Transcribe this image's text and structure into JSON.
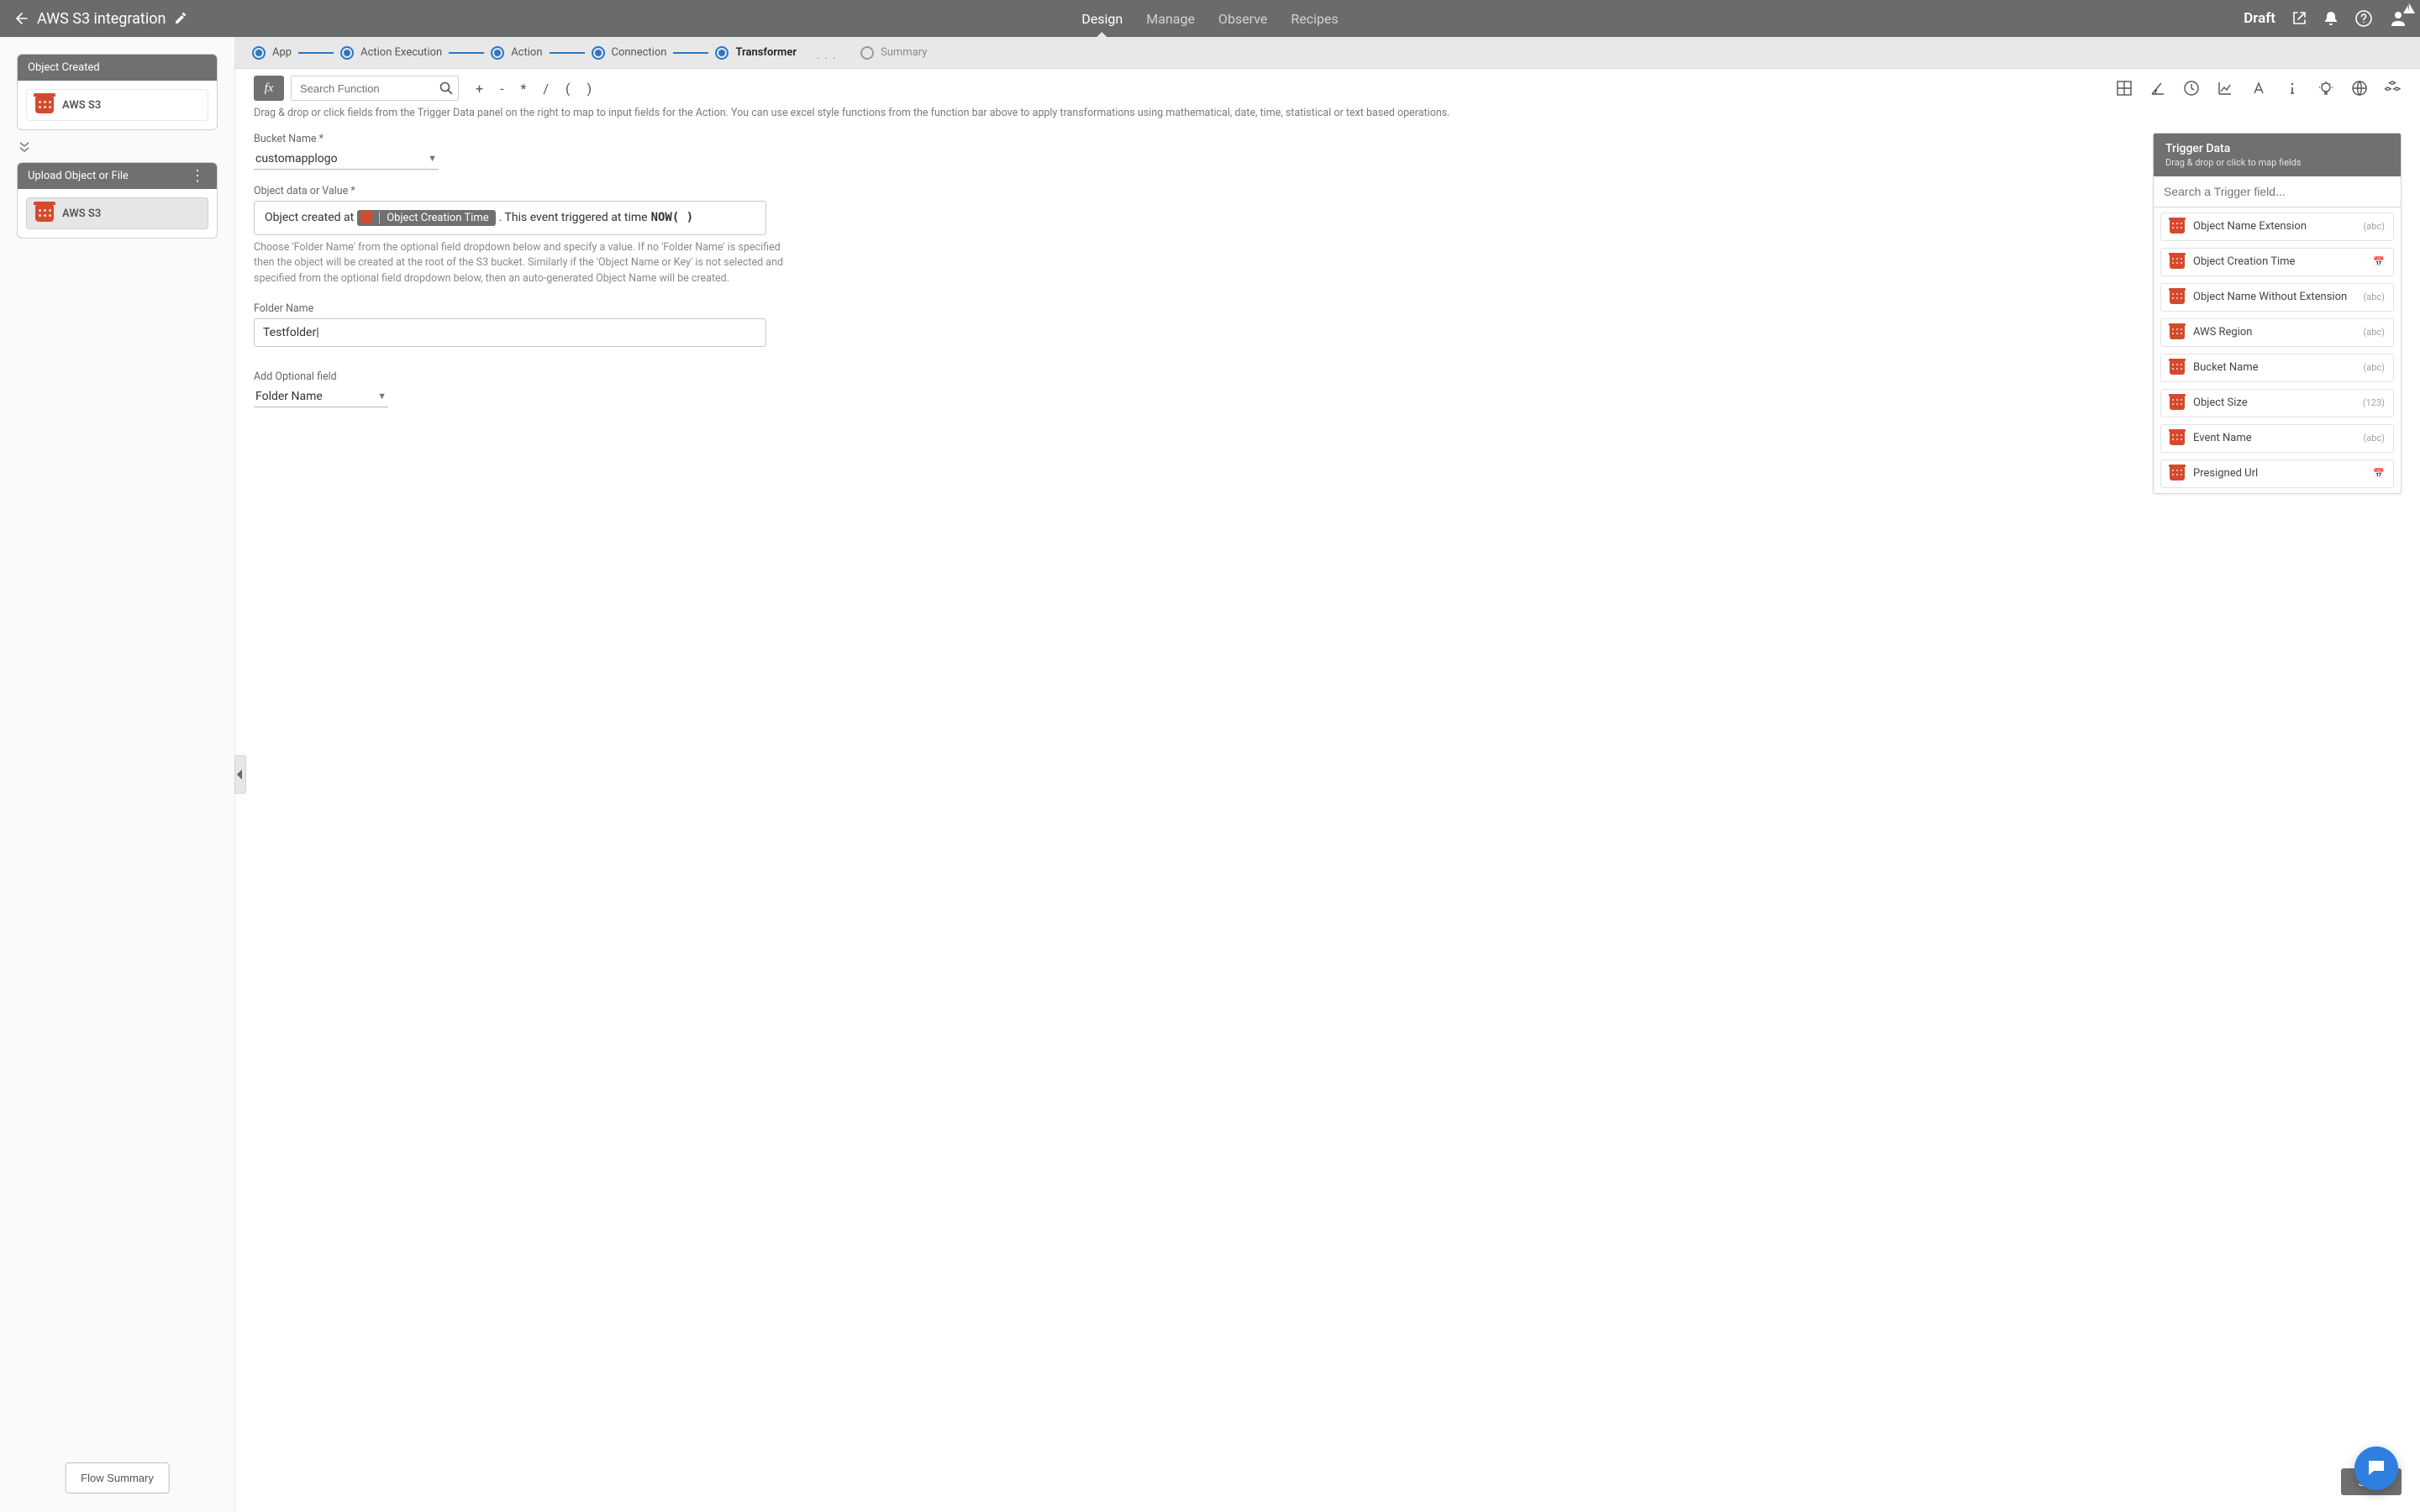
{
  "header": {
    "title": "AWS S3 integration",
    "tabs": [
      "Design",
      "Manage",
      "Observe",
      "Recipes"
    ],
    "active_tab": 0,
    "status": "Draft"
  },
  "sidebar": {
    "trigger_card": {
      "title": "Object Created",
      "service": "AWS S3"
    },
    "action_card": {
      "title": "Upload Object or File",
      "service": "AWS S3"
    },
    "flow_summary_btn": "Flow Summary"
  },
  "stepper": {
    "steps": [
      {
        "label": "App",
        "state": "done"
      },
      {
        "label": "Action Execution",
        "state": "done"
      },
      {
        "label": "Action",
        "state": "done"
      },
      {
        "label": "Connection",
        "state": "done"
      },
      {
        "label": "Transformer",
        "state": "active"
      },
      {
        "label": "Summary",
        "state": "inactive"
      }
    ]
  },
  "fx": {
    "search_placeholder": "Search Function",
    "operators": [
      "+",
      "-",
      "*",
      "/",
      "(",
      ")"
    ]
  },
  "hint_text": "Drag & drop or click fields from the Trigger Data panel on the right to map to input fields for the Action. You can use excel style functions from the function bar above to apply transformations using mathematical, date, time, statistical or text based operations.",
  "form": {
    "bucket": {
      "label": "Bucket Name *",
      "value": "customapplogo"
    },
    "object_value": {
      "label": "Object data or Value *",
      "prefix_text": "Object created at ",
      "chip_label": "Object Creation Time",
      "mid_text": ". This event triggered at time  ",
      "func": "NOW( )",
      "help": "Choose 'Folder Name' from the optional field dropdown below and specify a value. If no 'Folder Name' is specified then the object will be created at the root of the S3 bucket. Similarly if the 'Object Name or Key' is not selected and specified from the optional field dropdown below, then an auto-generated Object Name will be created."
    },
    "folder": {
      "label": "Folder Name",
      "value": "Testfolder"
    },
    "optional": {
      "label": "Add Optional field",
      "value": "Folder Name"
    }
  },
  "trigger_panel": {
    "title": "Trigger Data",
    "subtitle": "Drag & drop or click to map fields",
    "search_placeholder": "Search a Trigger field...",
    "fields": [
      {
        "name": "Object Name Extension",
        "type": "(abc)"
      },
      {
        "name": "Object Creation Time",
        "type": "📅"
      },
      {
        "name": "Object Name Without Extension",
        "type": "(abc)"
      },
      {
        "name": "AWS Region",
        "type": "(abc)"
      },
      {
        "name": "Bucket Name",
        "type": "(abc)"
      },
      {
        "name": "Object Size",
        "type": "(123)"
      },
      {
        "name": "Event Name",
        "type": "(abc)"
      },
      {
        "name": "Presigned Url",
        "type": "📅"
      }
    ]
  },
  "buttons": {
    "save": "Save"
  }
}
